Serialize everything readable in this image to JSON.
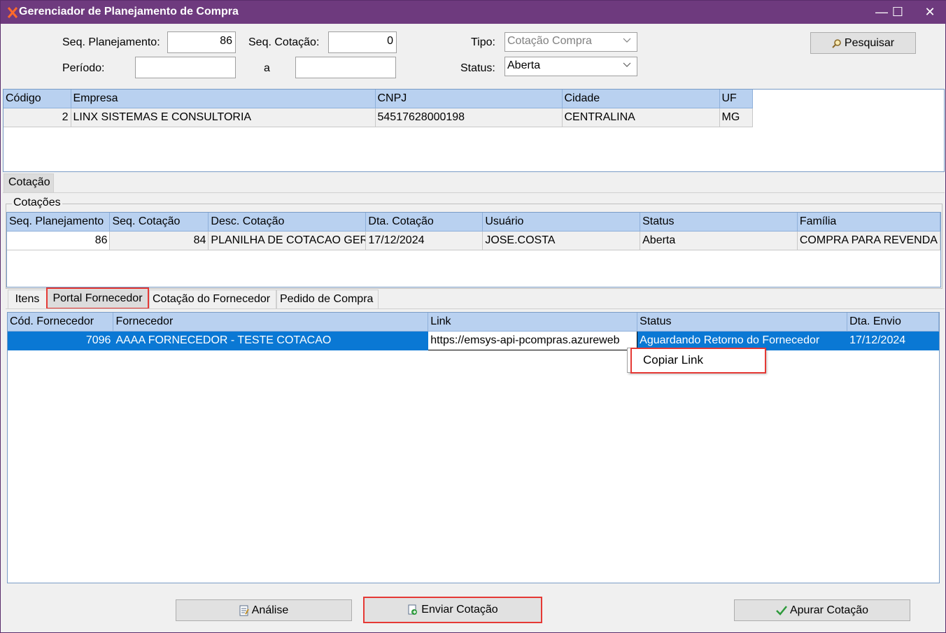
{
  "window": {
    "title": "Gerenciador de Planejamento de Compra",
    "minimize": "—",
    "maximize": "☐",
    "close": "✕"
  },
  "filters": {
    "seq_planejamento_label": "Seq. Planejamento:",
    "seq_planejamento_value": "86",
    "seq_cotacao_label": "Seq. Cotação:",
    "seq_cotacao_value": "0",
    "tipo_label": "Tipo:",
    "tipo_value": "Cotação Compra",
    "periodo_label": "Período:",
    "periodo_from": "",
    "periodo_sep": "a",
    "periodo_to": "",
    "status_label": "Status:",
    "status_value": "Aberta",
    "search_button": "Pesquisar"
  },
  "empresas": {
    "columns": [
      "Código",
      "Empresa",
      "CNPJ",
      "Cidade",
      "UF"
    ],
    "rows": [
      {
        "codigo": "2",
        "empresa": "LINX SISTEMAS E CONSULTORIA",
        "cnpj": "54517628000198",
        "cidade": "CENTRALINA",
        "uf": "MG"
      }
    ]
  },
  "main_tab": "Cotação",
  "cotacoes": {
    "group_label": "Cotações",
    "columns": [
      "Seq. Planejamento",
      "Seq. Cotação",
      "Desc. Cotação",
      "Dta. Cotação",
      "Usuário",
      "Status",
      "Família"
    ],
    "rows": [
      {
        "seq_planejamento": "86",
        "seq_cotacao": "84",
        "desc": "PLANILHA DE COTACAO GER",
        "data": "17/12/2024",
        "usuario": "JOSE.COSTA",
        "status": "Aberta",
        "familia": "COMPRA PARA REVENDA"
      }
    ]
  },
  "sub_tabs": [
    "Itens",
    "Portal Fornecedor",
    "Cotação do Fornecedor",
    "Pedido de Compra"
  ],
  "portal": {
    "columns": [
      "Cód. Fornecedor",
      "Fornecedor",
      "Link",
      "Status",
      "Dta. Envio"
    ],
    "rows": [
      {
        "codigo": "7096",
        "fornecedor": "AAAA FORNECEDOR - TESTE COTACAO",
        "link": "https://emsys-api-pcompras.azureweb",
        "status": "Aguardando Retorno do Fornecedor",
        "data": "17/12/2024"
      }
    ]
  },
  "context_menu": {
    "copy_link": "Copiar Link"
  },
  "footer": {
    "analise": "Análise",
    "enviar": "Enviar Cotação",
    "apurar": "Apurar Cotação"
  },
  "colors": {
    "titlebar": "#6e3a7e",
    "grid_header": "#b9d1f0",
    "selection": "#0a78d4",
    "highlight": "#e53935"
  }
}
